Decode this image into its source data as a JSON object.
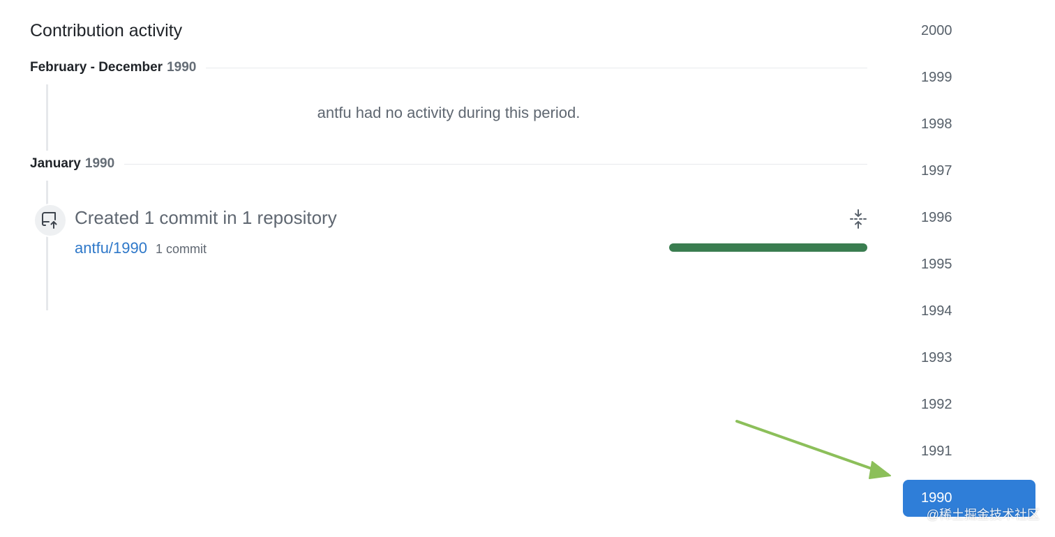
{
  "heading": "Contribution activity",
  "periods": [
    {
      "label": "February - December",
      "year": "1990",
      "empty_message": "antfu had no activity during this period."
    },
    {
      "label": "January",
      "year": "1990",
      "event": {
        "title": "Created 1 commit in 1 repository",
        "icon": "repo-push-icon",
        "repo": "antfu/1990",
        "count": "1 commit",
        "progress_fraction": 1.0
      }
    }
  ],
  "years": [
    "2000",
    "1999",
    "1998",
    "1997",
    "1996",
    "1995",
    "1994",
    "1993",
    "1992",
    "1991",
    "1990"
  ],
  "selected_year": "1990",
  "watermark": "@稀土掘金技术社区",
  "colors": {
    "accent": "#2f7ed8",
    "link": "#2e78c9",
    "progress": "#3a7d50",
    "annotation_arrow": "#8cbf5a"
  }
}
